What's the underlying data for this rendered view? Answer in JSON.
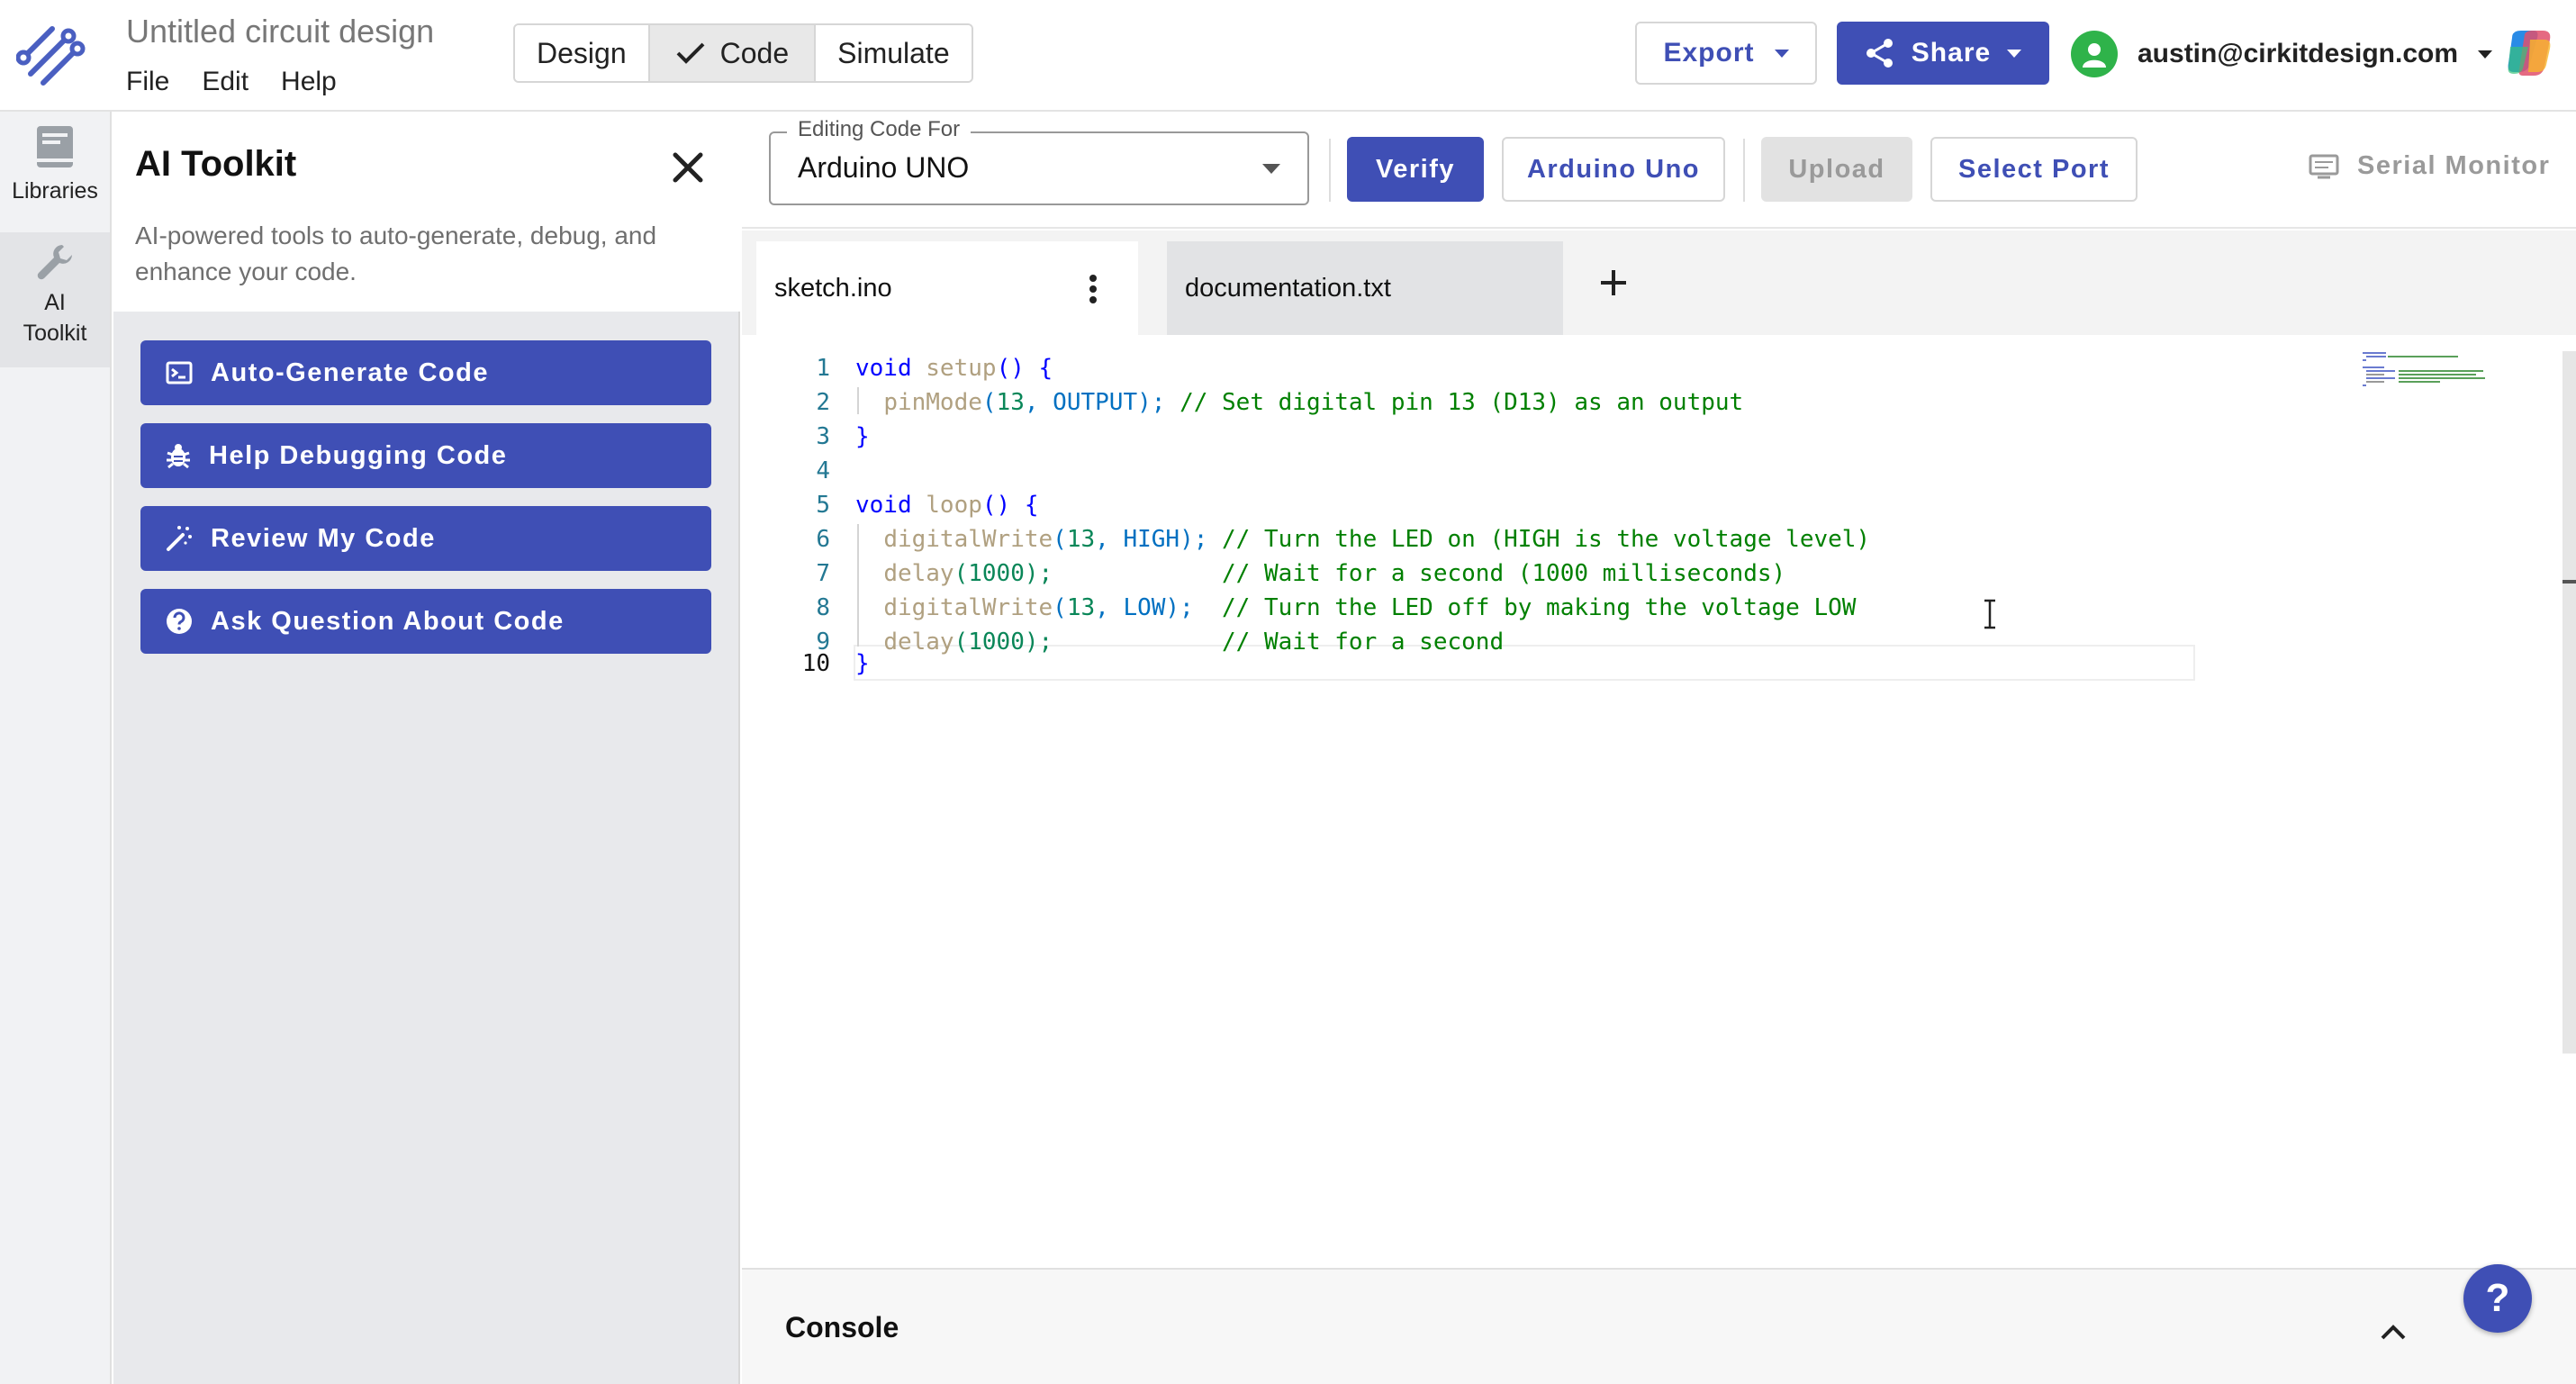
{
  "app": {
    "title": "Untitled circuit design",
    "menus": [
      "File",
      "Edit",
      "Help"
    ],
    "modes": [
      {
        "label": "Design",
        "active": false
      },
      {
        "label": "Code",
        "active": true
      },
      {
        "label": "Simulate",
        "active": false
      }
    ],
    "export_label": "Export",
    "share_label": "Share",
    "user_email": "austin@cirkitdesign.com",
    "brand_color": "#3f4fb5"
  },
  "rail": {
    "libraries_label": "Libraries",
    "ai_toolkit_line1": "AI",
    "ai_toolkit_line2": "Toolkit"
  },
  "ai_toolkit": {
    "title": "AI Toolkit",
    "description": "AI-powered tools to auto-generate, debug, and enhance your code.",
    "buttons": [
      {
        "label": "Auto-Generate Code",
        "icon": "terminal-icon"
      },
      {
        "label": "Help Debugging Code",
        "icon": "bug-icon"
      },
      {
        "label": "Review My Code",
        "icon": "magic-wand-icon"
      },
      {
        "label": "Ask Question About Code",
        "icon": "question-circle-icon"
      }
    ]
  },
  "toolbar": {
    "editing_for_label": "Editing Code For",
    "board_value": "Arduino UNO",
    "verify_label": "Verify",
    "board_button_label": "Arduino Uno",
    "upload_label": "Upload",
    "select_port_label": "Select Port",
    "serial_monitor_label": "Serial Monitor"
  },
  "tabs": [
    {
      "label": "sketch.ino",
      "active": true
    },
    {
      "label": "documentation.txt",
      "active": false
    }
  ],
  "editor": {
    "current_line": 10,
    "lines": [
      {
        "n": "1"
      },
      {
        "n": "2"
      },
      {
        "n": "3"
      },
      {
        "n": "4"
      },
      {
        "n": "5"
      },
      {
        "n": "6"
      },
      {
        "n": "7"
      },
      {
        "n": "8"
      },
      {
        "n": "9"
      },
      {
        "n": "10"
      }
    ],
    "code": {
      "l1_kw": "void",
      "l1_fn": "setup",
      "l1_rest": "() {",
      "l2_fn": "pinMode",
      "l2_open": "(",
      "l2_num": "13",
      "l2_sep": ", ",
      "l2_const": "OUTPUT",
      "l2_close": "); ",
      "l2_com": "// Set digital pin 13 (D13) as an output",
      "l3": "}",
      "l5_kw": "void",
      "l5_fn": "loop",
      "l5_rest": "() {",
      "l6_fn": "digitalWrite",
      "l6_open": "(",
      "l6_num": "13",
      "l6_sep": ", ",
      "l6_const": "HIGH",
      "l6_close": "); ",
      "l6_com": "// Turn the LED on (HIGH is the voltage level)",
      "l7_fn": "delay",
      "l7_open": "(",
      "l7_num": "1000",
      "l7_close": ");            ",
      "l7_com": "// Wait for a second (1000 milliseconds)",
      "l8_fn": "digitalWrite",
      "l8_open": "(",
      "l8_num": "13",
      "l8_sep": ", ",
      "l8_const": "LOW",
      "l8_close": ");  ",
      "l8_com": "// Turn the LED off by making the voltage LOW",
      "l9_fn": "delay",
      "l9_open": "(",
      "l9_num": "1000",
      "l9_close": ");            ",
      "l9_com": "// Wait for a second",
      "l10": "}"
    }
  },
  "console": {
    "title": "Console"
  },
  "help": {
    "label": "?"
  }
}
